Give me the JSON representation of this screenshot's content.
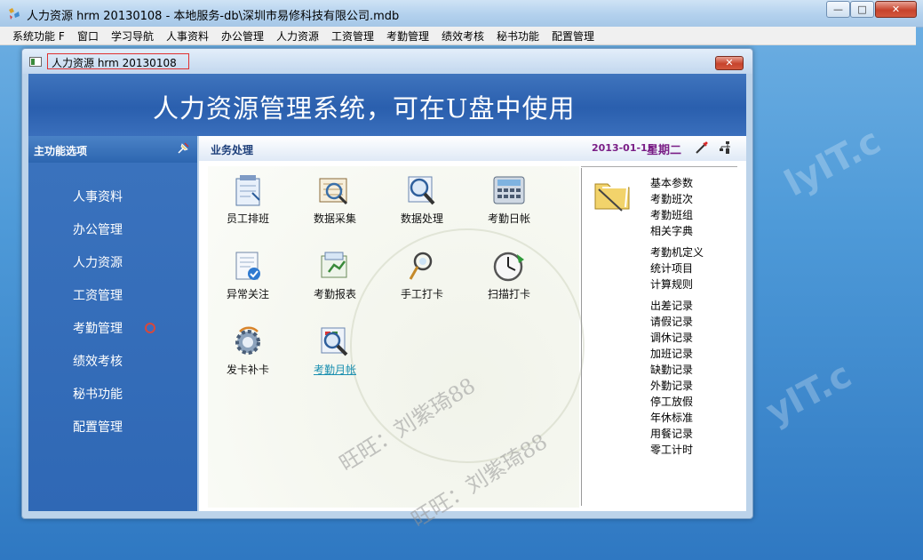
{
  "window": {
    "title": "人力资源 hrm 20130108 - 本地服务-db\\深圳市易修科技有限公司.mdb",
    "minimize_label": "—",
    "maximize_label": "□",
    "close_label": "✕"
  },
  "menubar": {
    "items": [
      {
        "label": "系统功能 F"
      },
      {
        "label": "窗口"
      },
      {
        "label": "学习导航"
      },
      {
        "label": "人事资料"
      },
      {
        "label": "办公管理"
      },
      {
        "label": "人力资源"
      },
      {
        "label": "工资管理"
      },
      {
        "label": "考勤管理"
      },
      {
        "label": "绩效考核"
      },
      {
        "label": "秘书功能"
      },
      {
        "label": "配置管理"
      }
    ]
  },
  "child_window": {
    "title": "人力资源 hrm 20130108",
    "close_label": "✕"
  },
  "banner": {
    "text": "人力资源管理系统，可在U盘中使用"
  },
  "nav": {
    "title": "主功能选项",
    "items": [
      {
        "label": "人事资料"
      },
      {
        "label": "办公管理"
      },
      {
        "label": "人力资源"
      },
      {
        "label": "工资管理"
      },
      {
        "label": "考勤管理"
      },
      {
        "label": "绩效考核"
      },
      {
        "label": "秘书功能"
      },
      {
        "label": "配置管理"
      }
    ]
  },
  "main": {
    "title": "业务处理",
    "date": "2013-01-15",
    "weekday": "星期二",
    "tiles": [
      {
        "label": "员工排班",
        "icon": "schedule-icon"
      },
      {
        "label": "数据采集",
        "icon": "data-collect-icon"
      },
      {
        "label": "数据处理",
        "icon": "magnifier-icon"
      },
      {
        "label": "考勤日帐",
        "icon": "calculator-icon"
      },
      {
        "label": "异常关注",
        "icon": "document-check-icon"
      },
      {
        "label": "考勤报表",
        "icon": "report-icon"
      },
      {
        "label": "手工打卡",
        "icon": "manual-punch-icon"
      },
      {
        "label": "扫描打卡",
        "icon": "clock-icon"
      },
      {
        "label": "发卡补卡",
        "icon": "gear-icon"
      },
      {
        "label": "考勤月帐",
        "icon": "magnifier-icon"
      }
    ],
    "links": [
      {
        "label": "基本参数"
      },
      {
        "label": "考勤班次"
      },
      {
        "label": "考勤班组"
      },
      {
        "label": "相关字典"
      },
      {
        "label": "考勤机定义"
      },
      {
        "label": "统计项目"
      },
      {
        "label": "计算规则"
      },
      {
        "label": "出差记录"
      },
      {
        "label": "请假记录"
      },
      {
        "label": "调休记录"
      },
      {
        "label": "加班记录"
      },
      {
        "label": "缺勤记录"
      },
      {
        "label": "外勤记录"
      },
      {
        "label": "停工放假"
      },
      {
        "label": "年休标准"
      },
      {
        "label": "用餐记录"
      },
      {
        "label": "零工计时"
      }
    ]
  },
  "watermarks": {
    "text1": "旺旺：刘紫琦88",
    "text2": "旺旺：刘紫琦88"
  },
  "colors": {
    "banner": "#2a5fae",
    "nav": "#3a72bd",
    "date_text": "#7a1e86"
  }
}
